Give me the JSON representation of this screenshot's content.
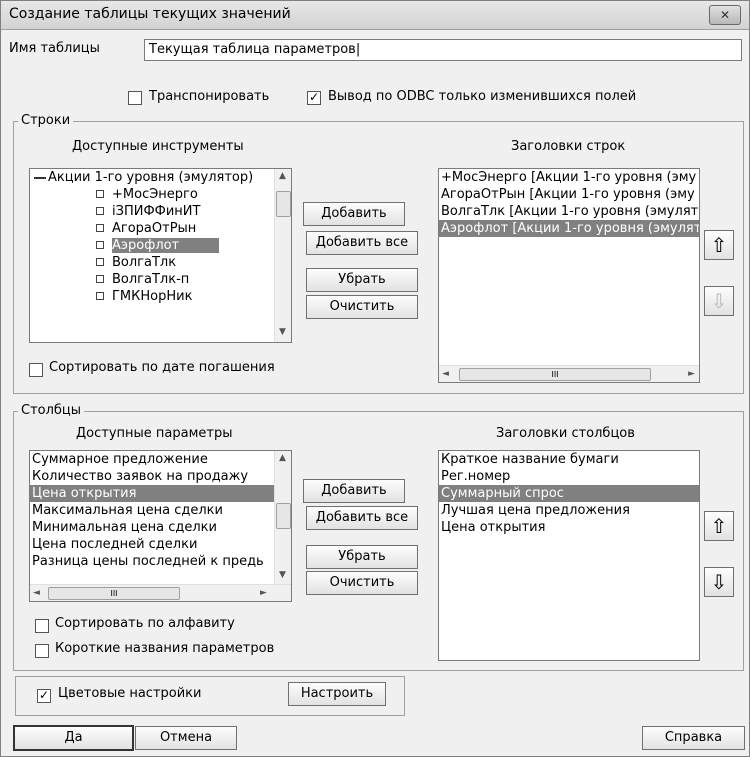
{
  "window": {
    "title": "Создание таблицы текущих значений",
    "close": "✕"
  },
  "name_field": {
    "label": "Имя таблицы",
    "value": "Текущая таблица параметров|"
  },
  "options": {
    "transpose_label": "Транспонировать",
    "transpose_checked": false,
    "odbc_label": "Вывод по ODBC только изменившихся полей",
    "odbc_checked": true
  },
  "rows": {
    "group_label": "Строки",
    "available_header": "Доступные инструменты",
    "headers_header": "Заголовки строк",
    "available_root": "Акции 1-го уровня (эмулятор)",
    "available_items": [
      "+МосЭнерго",
      "iЗПИФФинИТ",
      "АгораОтРын",
      "Аэрофлот",
      "ВолгаТлк",
      "ВолгаТлк-п",
      "ГМКНорНик"
    ],
    "selected_available": "Аэрофлот",
    "header_items": [
      "+МосЭнерго [Акции 1-го уровня (эму",
      "АгораОтРын [Акции 1-го уровня (эму",
      "ВолгаТлк [Акции 1-го уровня (эмулят",
      "Аэрофлот [Акции 1-го уровня (эмулят"
    ],
    "selected_header": "Аэрофлот [Акции 1-го уровня (эмулят",
    "buttons": {
      "add": "Добавить",
      "add_all": "Добавить все",
      "remove": "Убрать",
      "clear": "Очистить"
    },
    "sort_label": "Сортировать по дате погашения",
    "sort_checked": false
  },
  "columns": {
    "group_label": "Столбцы",
    "available_header": "Доступные параметры",
    "headers_header": "Заголовки столбцов",
    "available_items": [
      "Суммарное предложение",
      "Количество заявок на продажу",
      "Цена открытия",
      "Максимальная цена сделки",
      "Минимальная цена сделки",
      "Цена последней сделки",
      "Разница цены последней к предь"
    ],
    "selected_available": "Цена открытия",
    "header_items": [
      "Краткое название бумаги",
      "Рег.номер",
      "Суммарный спрос",
      "Лучшая цена предложения",
      "Цена открытия"
    ],
    "selected_header": "Суммарный спрос",
    "buttons": {
      "add": "Добавить",
      "add_all": "Добавить все",
      "remove": "Убрать",
      "clear": "Очистить"
    },
    "sort_alpha_label": "Сортировать по алфавиту",
    "sort_alpha_checked": false,
    "short_names_label": "Короткие названия параметров",
    "short_names_checked": false
  },
  "color_settings": {
    "label": "Цветовые настройки",
    "checked": true,
    "configure": "Настроить"
  },
  "footer": {
    "ok": "Да",
    "cancel": "Отмена",
    "help": "Справка"
  },
  "scroll_glyph": "III",
  "icons": {
    "up": "up-arrow-icon",
    "down": "down-arrow-icon",
    "tree_collapse": "tree-collapse-icon",
    "tree_bullet": "tree-bullet-icon"
  }
}
